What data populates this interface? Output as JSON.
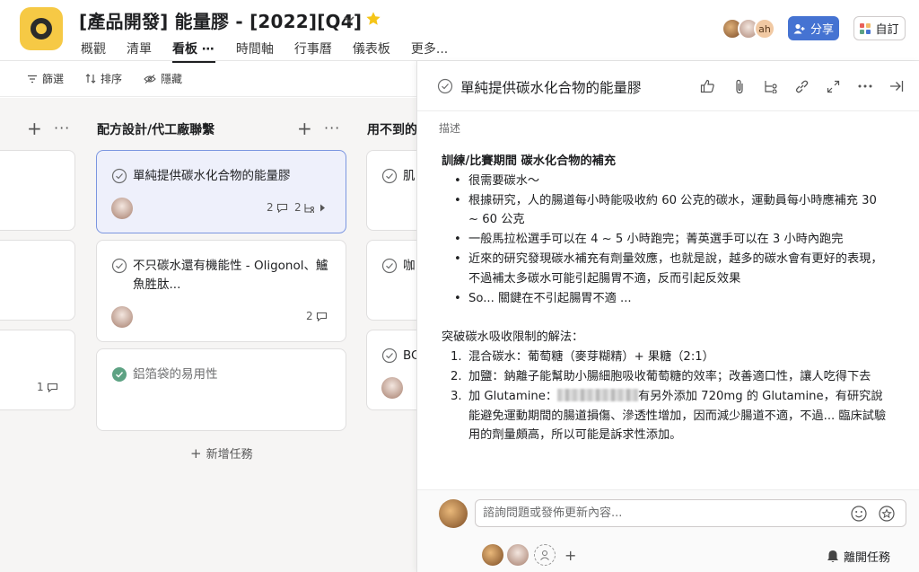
{
  "header": {
    "title": "[產品開發] 能量膠 - [2022][Q4]",
    "avatar_overflow": "ah",
    "share_label": "分享",
    "customize_label": "自訂",
    "colors": {
      "brand_yellow": "#f6c945",
      "share_blue": "#4573d2",
      "star": "#f5c518"
    }
  },
  "nav": {
    "items": [
      "概觀",
      "清單",
      "看板",
      "時間軸",
      "行事曆",
      "儀表板",
      "更多..."
    ],
    "active_dots": "⋯"
  },
  "toolbar": {
    "filter": "篩選",
    "sort": "排序",
    "hide": "隱藏"
  },
  "board": {
    "columns": [
      {
        "title": "",
        "cards": [
          {
            "title": "",
            "comments": ""
          },
          {
            "title": "",
            "comments": ""
          },
          {
            "title": "",
            "comments": "1"
          }
        ]
      },
      {
        "title": "配方設計/代工廠聯繫",
        "cards": [
          {
            "title": "單純提供碳水化合物的能量膠",
            "comments": "2",
            "subtasks": "2",
            "selected": true
          },
          {
            "title": "不只碳水還有機能性 - Oligonol、鱸魚胜肽...",
            "comments": "2"
          },
          {
            "title": "鋁箔袋的易用性",
            "completed": true
          }
        ],
        "add_task": "新增任務"
      },
      {
        "title": "用不到的",
        "cards": [
          {
            "title": "肌"
          },
          {
            "title": "咖"
          },
          {
            "title": "BC"
          }
        ]
      }
    ]
  },
  "pane": {
    "title": "單純提供碳水化合物的能量膠",
    "description_label": "描述",
    "heading": "訓練/比賽期間 碳水化合物的補充",
    "bullets": [
      "很需要碳水～",
      "根據研究，人的腸道每小時能吸收約 60 公克的碳水，運動員每小時應補充 30 ~ 60 公克",
      "一般馬拉松選手可以在 4 ~ 5 小時跑完；菁英選手可以在 3 小時內跑完",
      "近來的研究發現碳水補充有劑量效應，也就是說，越多的碳水會有更好的表現，不過補太多碳水可能引起腸胃不適，反而引起反效果",
      "So... 關鍵在不引起腸胃不適 ..."
    ],
    "solutions_heading": "突破碳水吸收限制的解法：",
    "solutions": [
      {
        "num": "1.",
        "text": "混合碳水：葡萄糖（麥芽糊精）+ 果糖（2:1）"
      },
      {
        "num": "2.",
        "text": "加鹽：鈉離子能幫助小腸細胞吸收葡萄糖的效率；改善適口性，讓人吃得下去"
      },
      {
        "num": "3.",
        "text_before": "加 Glutamine：",
        "text_after": "有另外添加 720mg 的 Glutamine，有研究說能避免運動期間的腸道損傷、滲透性增加，因而減少腸道不適，不過... 臨床試驗用的劑量頗高，所以可能是訴求性添加。"
      }
    ],
    "comment_placeholder": "諮詢問題或發佈更新內容...",
    "leave_label": "離開任務"
  }
}
